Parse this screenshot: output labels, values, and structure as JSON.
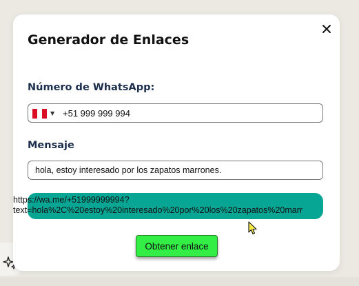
{
  "dialog": {
    "title": "Generador de Enlaces",
    "close_icon": "close-icon"
  },
  "phone": {
    "label": "Número de WhatsApp:",
    "country_flag": "peru-flag-icon",
    "flag_colors": [
      "#d91023",
      "#ffffff",
      "#d91023"
    ],
    "value": "+51 999 999 994"
  },
  "message": {
    "label": "Mensaje",
    "value": "hola, estoy interesado por los zapatos marrones."
  },
  "result": {
    "link_line1": "https://wa.me/+51999999994?",
    "link_line2": "text=hola%2C%20estoy%20interesado%20por%20los%20zapatos%20marr",
    "bar_color": "#07a593"
  },
  "actions": {
    "get_link_label": "Obtener enlace",
    "button_color": "#33ee44"
  },
  "side_widget": {
    "icon": "sparkle-icon"
  }
}
